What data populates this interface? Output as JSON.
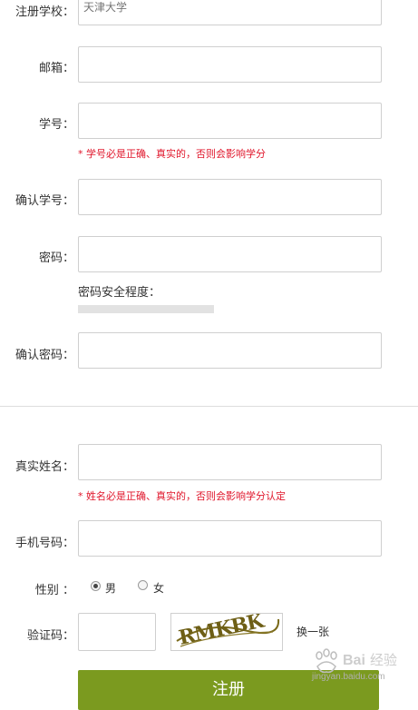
{
  "form": {
    "school": {
      "label": "注册学校：",
      "placeholder": "天津大学"
    },
    "email": {
      "label": "邮箱："
    },
    "student_id": {
      "label": "学号：",
      "hint": "* 学号必是正确、真实的，否则会影响学分"
    },
    "confirm_student_id": {
      "label": "确认学号："
    },
    "password": {
      "label": "密码：",
      "strength_label": "密码安全程度：",
      "strength_level": 0
    },
    "confirm_password": {
      "label": "确认密码："
    },
    "real_name": {
      "label": "真实姓名：",
      "hint": "* 姓名必是正确、真实的，否则会影响学分认定"
    },
    "phone": {
      "label": "手机号码："
    },
    "gender": {
      "label": "性别 ：",
      "options": [
        "男",
        "女"
      ],
      "selected": "男"
    },
    "captcha": {
      "label": "验证码：",
      "image_text": "RMKBK",
      "refresh_label": "换一张"
    },
    "submit_label": "注册"
  },
  "watermark": {
    "brand": "Baidu经验",
    "url": "jingyan.baidu.com"
  },
  "colors": {
    "accent": "#7b9a1f",
    "hint": "#e0162b",
    "border": "#cfcfcf"
  }
}
